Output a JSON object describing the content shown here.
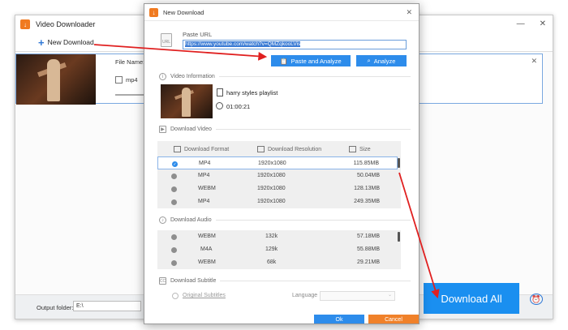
{
  "main": {
    "title": "Video Downloader",
    "minimize": "—",
    "close": "✕",
    "new_download": "New Download",
    "task": {
      "file_name_label": "File Name: h",
      "format": "mp4",
      "close": "✕"
    },
    "output_folder_label": "Output folder:",
    "output_folder_value": "E:\\",
    "download_all": "Download All"
  },
  "dialog": {
    "title": "New Download",
    "close": "✕",
    "paste_url_label": "Paste URL",
    "url": "https://www.youtube.com/watch?v=QMZqkooLVis",
    "paste_analyze": "Paste and Analyze",
    "analyze": "Analyze",
    "video_info_label": "Video Information",
    "video_title": "harry styles playlist",
    "duration": "01:00:21",
    "download_video_label": "Download Video",
    "video_headers": [
      "Download Format",
      "Download Resolution",
      "Size"
    ],
    "video_rows": [
      {
        "format": "MP4",
        "res": "1920x1080",
        "size": "115.85MB",
        "selected": true
      },
      {
        "format": "MP4",
        "res": "1920x1080",
        "size": "50.04MB",
        "selected": false
      },
      {
        "format": "WEBM",
        "res": "1920x1080",
        "size": "128.13MB",
        "selected": false
      },
      {
        "format": "MP4",
        "res": "1920x1080",
        "size": "249.35MB",
        "selected": false
      }
    ],
    "download_audio_label": "Download Audio",
    "audio_rows": [
      {
        "format": "WEBM",
        "rate": "132k",
        "size": "57.18MB"
      },
      {
        "format": "M4A",
        "rate": "129k",
        "size": "55.88MB"
      },
      {
        "format": "WEBM",
        "rate": "68k",
        "size": "29.21MB"
      }
    ],
    "download_subtitle_label": "Download Subtitle",
    "original_subtitles": "Original Subtitles",
    "language_label": "Language",
    "ok": "Ok",
    "cancel": "Cancel"
  },
  "colors": {
    "accent": "#2d8ceb",
    "download_all": "#1a8ff0",
    "cancel": "#f0812a",
    "arrow": "#e02020"
  }
}
